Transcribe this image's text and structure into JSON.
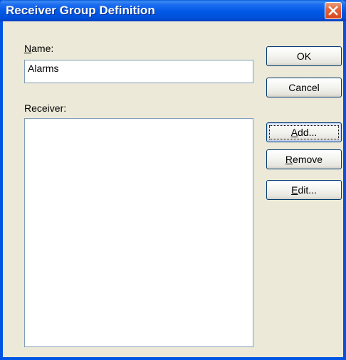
{
  "window": {
    "title": "Receiver Group Definition",
    "close_icon": "close-icon"
  },
  "name_field": {
    "label_mnemonic": "N",
    "label_rest": "ame:",
    "value": "Alarms"
  },
  "receiver": {
    "label": "Receiver:",
    "items": []
  },
  "buttons": {
    "ok": "OK",
    "cancel": "Cancel",
    "add_mnemonic": "A",
    "add_rest": "dd...",
    "remove_mnemonic": "R",
    "remove_rest": "emove",
    "edit_mnemonic": "E",
    "edit_rest": "dit..."
  },
  "colors": {
    "titlebar": "#0058e6",
    "dialog_bg": "#ece9d8",
    "field_border": "#7f9db9",
    "close_button": "#d8471d"
  }
}
